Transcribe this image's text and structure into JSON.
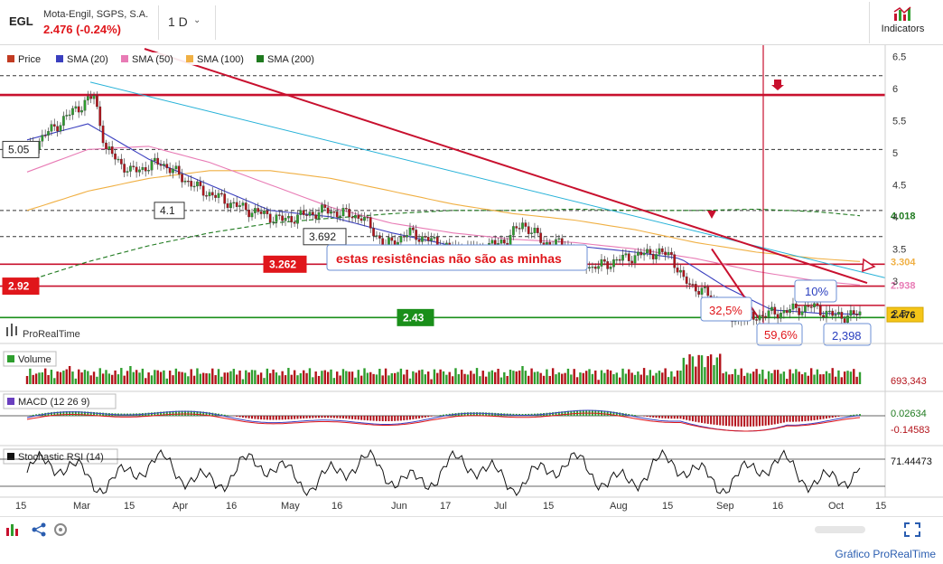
{
  "header": {
    "ticker": "EGL",
    "company": "Mota-Engil, SGPS, S.A.",
    "last": "2.476 (-0.24%)",
    "period": "1 D",
    "indicators_label": "Indicators"
  },
  "footer": {
    "link": "Gráfico ProRealTime"
  },
  "colors": {
    "up": "#2e9e2e",
    "down": "#b3121a",
    "sma20": "#3a3fbf",
    "sma50": "#e87bb5",
    "sma100": "#f0b044",
    "sma200": "#1f7a1f",
    "trend_red": "#c8102e",
    "trend_cyan": "#27b2d8",
    "support_green": "#1a8f1a"
  },
  "chart_data": {
    "type": "candlestick",
    "legend": [
      {
        "name": "Price",
        "color": "#c23b22"
      },
      {
        "name": "SMA (20)",
        "color": "#3a3fbf"
      },
      {
        "name": "SMA (50)",
        "color": "#e87bb5"
      },
      {
        "name": "SMA (100)",
        "color": "#f0b044"
      },
      {
        "name": "SMA (200)",
        "color": "#1f7a1f"
      }
    ],
    "watermark": "ProRealTime",
    "y_ticks": [
      "6.5",
      "6",
      "5.5",
      "5",
      "4.5",
      "4",
      "3.5",
      "3",
      "2.5"
    ],
    "ylim": [
      2.28,
      6.62
    ],
    "x_ticks": [
      "15",
      "Mar",
      "15",
      "Apr",
      "16",
      "May",
      "16",
      "Jun",
      "17",
      "Jul",
      "15",
      "Aug",
      "15",
      "Sep",
      "16",
      "Oct",
      "15"
    ],
    "price_keypoints": [
      [
        0,
        5.02
      ],
      [
        6,
        5.28
      ],
      [
        16,
        5.68
      ],
      [
        22,
        5.88
      ],
      [
        26,
        5.05
      ],
      [
        34,
        4.7
      ],
      [
        44,
        4.85
      ],
      [
        56,
        4.45
      ],
      [
        70,
        4.15
      ],
      [
        84,
        3.95
      ],
      [
        98,
        4.1
      ],
      [
        110,
        4.0
      ],
      [
        118,
        3.55
      ],
      [
        126,
        3.75
      ],
      [
        140,
        3.5
      ],
      [
        150,
        3.5
      ],
      [
        158,
        3.65
      ],
      [
        163,
        3.9
      ],
      [
        170,
        3.6
      ],
      [
        178,
        3.55
      ],
      [
        186,
        3.2
      ],
      [
        196,
        3.35
      ],
      [
        206,
        3.45
      ],
      [
        212,
        3.4
      ],
      [
        216,
        3.0
      ],
      [
        222,
        2.85
      ],
      [
        228,
        2.6
      ],
      [
        232,
        2.42
      ],
      [
        240,
        2.45
      ],
      [
        252,
        2.55
      ],
      [
        258,
        2.6
      ],
      [
        266,
        2.45
      ],
      [
        272,
        2.47
      ],
      [
        274,
        2.476
      ]
    ],
    "sma20_points": [
      [
        0,
        5.2
      ],
      [
        20,
        5.45
      ],
      [
        40,
        4.9
      ],
      [
        60,
        4.5
      ],
      [
        80,
        4.1
      ],
      [
        100,
        4.0
      ],
      [
        120,
        3.75
      ],
      [
        140,
        3.55
      ],
      [
        160,
        3.55
      ],
      [
        180,
        3.55
      ],
      [
        200,
        3.45
      ],
      [
        215,
        3.35
      ],
      [
        230,
        2.9
      ],
      [
        245,
        2.55
      ],
      [
        260,
        2.5
      ],
      [
        274,
        2.48
      ]
    ],
    "sma50_points": [
      [
        0,
        4.7
      ],
      [
        20,
        5.05
      ],
      [
        40,
        5.1
      ],
      [
        60,
        4.85
      ],
      [
        80,
        4.5
      ],
      [
        100,
        4.15
      ],
      [
        120,
        3.9
      ],
      [
        140,
        3.75
      ],
      [
        160,
        3.65
      ],
      [
        180,
        3.6
      ],
      [
        200,
        3.5
      ],
      [
        220,
        3.35
      ],
      [
        240,
        3.15
      ],
      [
        260,
        3.0
      ],
      [
        274,
        2.938
      ]
    ],
    "sma100_points": [
      [
        0,
        4.1
      ],
      [
        20,
        4.4
      ],
      [
        40,
        4.6
      ],
      [
        60,
        4.72
      ],
      [
        80,
        4.72
      ],
      [
        100,
        4.6
      ],
      [
        120,
        4.4
      ],
      [
        140,
        4.2
      ],
      [
        160,
        4.05
      ],
      [
        180,
        3.95
      ],
      [
        200,
        3.8
      ],
      [
        220,
        3.6
      ],
      [
        240,
        3.45
      ],
      [
        260,
        3.35
      ],
      [
        274,
        3.304
      ]
    ],
    "sma200_points": [
      [
        0,
        3.0
      ],
      [
        20,
        3.3
      ],
      [
        40,
        3.55
      ],
      [
        60,
        3.75
      ],
      [
        80,
        3.9
      ],
      [
        100,
        3.98
      ],
      [
        120,
        4.05
      ],
      [
        140,
        4.1
      ],
      [
        160,
        4.1
      ],
      [
        180,
        4.12
      ],
      [
        200,
        4.1
      ],
      [
        220,
        4.1
      ],
      [
        240,
        4.12
      ],
      [
        260,
        4.08
      ],
      [
        274,
        4.018
      ]
    ],
    "horizontal_lines": [
      {
        "value": 6.2,
        "style": "dashed",
        "color": "#333333"
      },
      {
        "value": 5.9,
        "style": "solid",
        "color": "#c8102e"
      },
      {
        "value": 5.05,
        "style": "dashed",
        "color": "#333333"
      },
      {
        "value": 4.1,
        "style": "dashed",
        "color": "#333333"
      },
      {
        "value": 3.692,
        "style": "dashed",
        "color": "#333333"
      },
      {
        "value": 3.262,
        "style": "solid",
        "color": "#c8102e"
      },
      {
        "value": 2.92,
        "style": "solid",
        "color": "#c8102e"
      },
      {
        "value": 2.62,
        "style": "solid",
        "color": "#c8102e"
      },
      {
        "value": 2.43,
        "style": "solid",
        "color": "#1a8f1a"
      }
    ],
    "level_labels": [
      {
        "text": "5.05",
        "value": 5.05,
        "style": "box"
      },
      {
        "text": "4.1",
        "value": 4.1,
        "style": "box"
      },
      {
        "text": "3.692",
        "value": 3.692,
        "style": "box"
      },
      {
        "text": "3.262",
        "value": 3.262,
        "style": "red"
      },
      {
        "text": "2.92",
        "value": 2.92,
        "style": "red"
      },
      {
        "text": "2.43",
        "value": 2.43,
        "style": "green"
      }
    ],
    "right_labels": [
      {
        "text": "4.018",
        "value": 4.018,
        "color": "#1f7a1f",
        "bg": "#ffffff"
      },
      {
        "text": "3.304",
        "value": 3.304,
        "color": "#f0b044",
        "bg": "#ffffff"
      },
      {
        "text": "2.938",
        "value": 2.938,
        "color": "#e87bb5",
        "bg": "#ffffff"
      },
      {
        "text": "2.476",
        "value": 2.476,
        "color": "#222222",
        "bg": "#f5c518"
      }
    ],
    "annotations": {
      "resistance_text": "estas resistências não são as minhas",
      "pct1": "32,5%",
      "pct2": "59,6%",
      "pct3": "10%",
      "low_value": "2,398"
    },
    "volume": {
      "title": "Volume",
      "last": "693,343"
    },
    "macd": {
      "title": "MACD (12 26 9)",
      "value1": "0.02634",
      "value2": "-0.14583"
    },
    "stoch": {
      "title": "Stochastic RSI (14)",
      "value": "71.44473"
    }
  }
}
